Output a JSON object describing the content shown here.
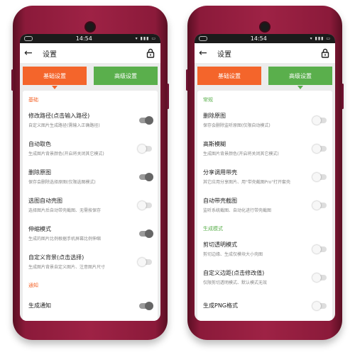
{
  "left": {
    "status_time": "14:54",
    "title": "设置",
    "tabs": [
      {
        "label": "基础设置"
      },
      {
        "label": "高级设置"
      }
    ],
    "active_tab": 0,
    "sections": [
      {
        "header": "基础",
        "items": [
          {
            "title": "修改路径(点击输入路径)",
            "subtitle": "自定义图片生成路径(需输入正确路径)",
            "on": true
          },
          {
            "title": "自动取色",
            "subtitle": "生成图片背景颜色(开启将关闭其它模式)",
            "on": false
          },
          {
            "title": "删除原图",
            "subtitle": "保存会删除选择原图(仅限选图模式)",
            "on": true
          },
          {
            "title": "选图自动壳图",
            "subtitle": "选择图片后自动带壳截图、无需按保存",
            "on": false
          },
          {
            "title": "伸缩模式",
            "subtitle": "生成的图片比例根据手机屏幕比例伸缩",
            "on": true
          },
          {
            "title": "自定义背景(点击选择)",
            "subtitle": "生成图片背景自定义图片、注意图片尺寸",
            "on": false
          }
        ]
      },
      {
        "header": "通知",
        "items": [
          {
            "title": "生成通知",
            "subtitle": "",
            "on": true
          }
        ]
      }
    ]
  },
  "right": {
    "status_time": "14:54",
    "title": "设置",
    "tabs": [
      {
        "label": "基础设置"
      },
      {
        "label": "高级设置"
      }
    ],
    "active_tab": 1,
    "sections": [
      {
        "header": "常规",
        "items": [
          {
            "title": "删除原图",
            "subtitle": "保存会删除监听原图(仅限自动模式)",
            "on": false
          },
          {
            "title": "高斯模糊",
            "subtitle": "生成图片背景颜色(开启将关闭其它模式)",
            "on": false
          },
          {
            "title": "分享调用带壳",
            "subtitle": "其它应用分享图片、用\"带壳截图Pro\"打开套壳",
            "on": false
          },
          {
            "title": "自动带壳截图",
            "subtitle": "监听系统截图、自动化进行带壳截图",
            "on": false
          }
        ]
      },
      {
        "header": "生成模式",
        "items": [
          {
            "title": "剪切透明模式",
            "subtitle": "剪切边缘、生成仅模块大小壳图",
            "on": false
          },
          {
            "title": "自定义边距(点击修改值)",
            "subtitle": "仅限剪切透明模式、默认模式无效",
            "on": false
          },
          {
            "title": "生成PNG格式",
            "subtitle": "",
            "on": false
          }
        ]
      }
    ]
  },
  "colors": {
    "orange": "#f4652b",
    "green": "#5aaf4c",
    "phone": "#9e2245"
  },
  "icons": {
    "back": "back-arrow-icon",
    "lock": "lock-icon"
  }
}
